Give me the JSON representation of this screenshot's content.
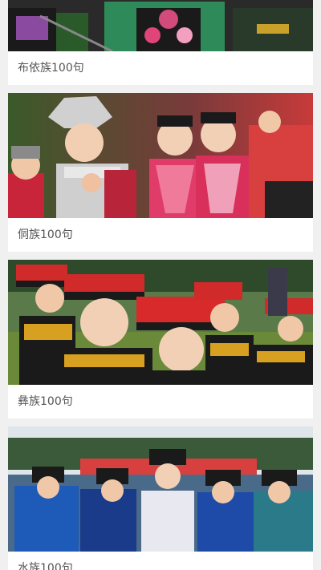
{
  "cards": [
    {
      "title": "布依族100句",
      "image": "buyi-photo"
    },
    {
      "title": "侗族100句",
      "image": "dong-photo"
    },
    {
      "title": "彝族100句",
      "image": "yi-photo"
    },
    {
      "title": "水族100句",
      "image": "shui-photo"
    }
  ],
  "colors": {
    "page_background": "#f0f0f0",
    "card_background": "#ffffff",
    "caption_text": "#555555"
  }
}
